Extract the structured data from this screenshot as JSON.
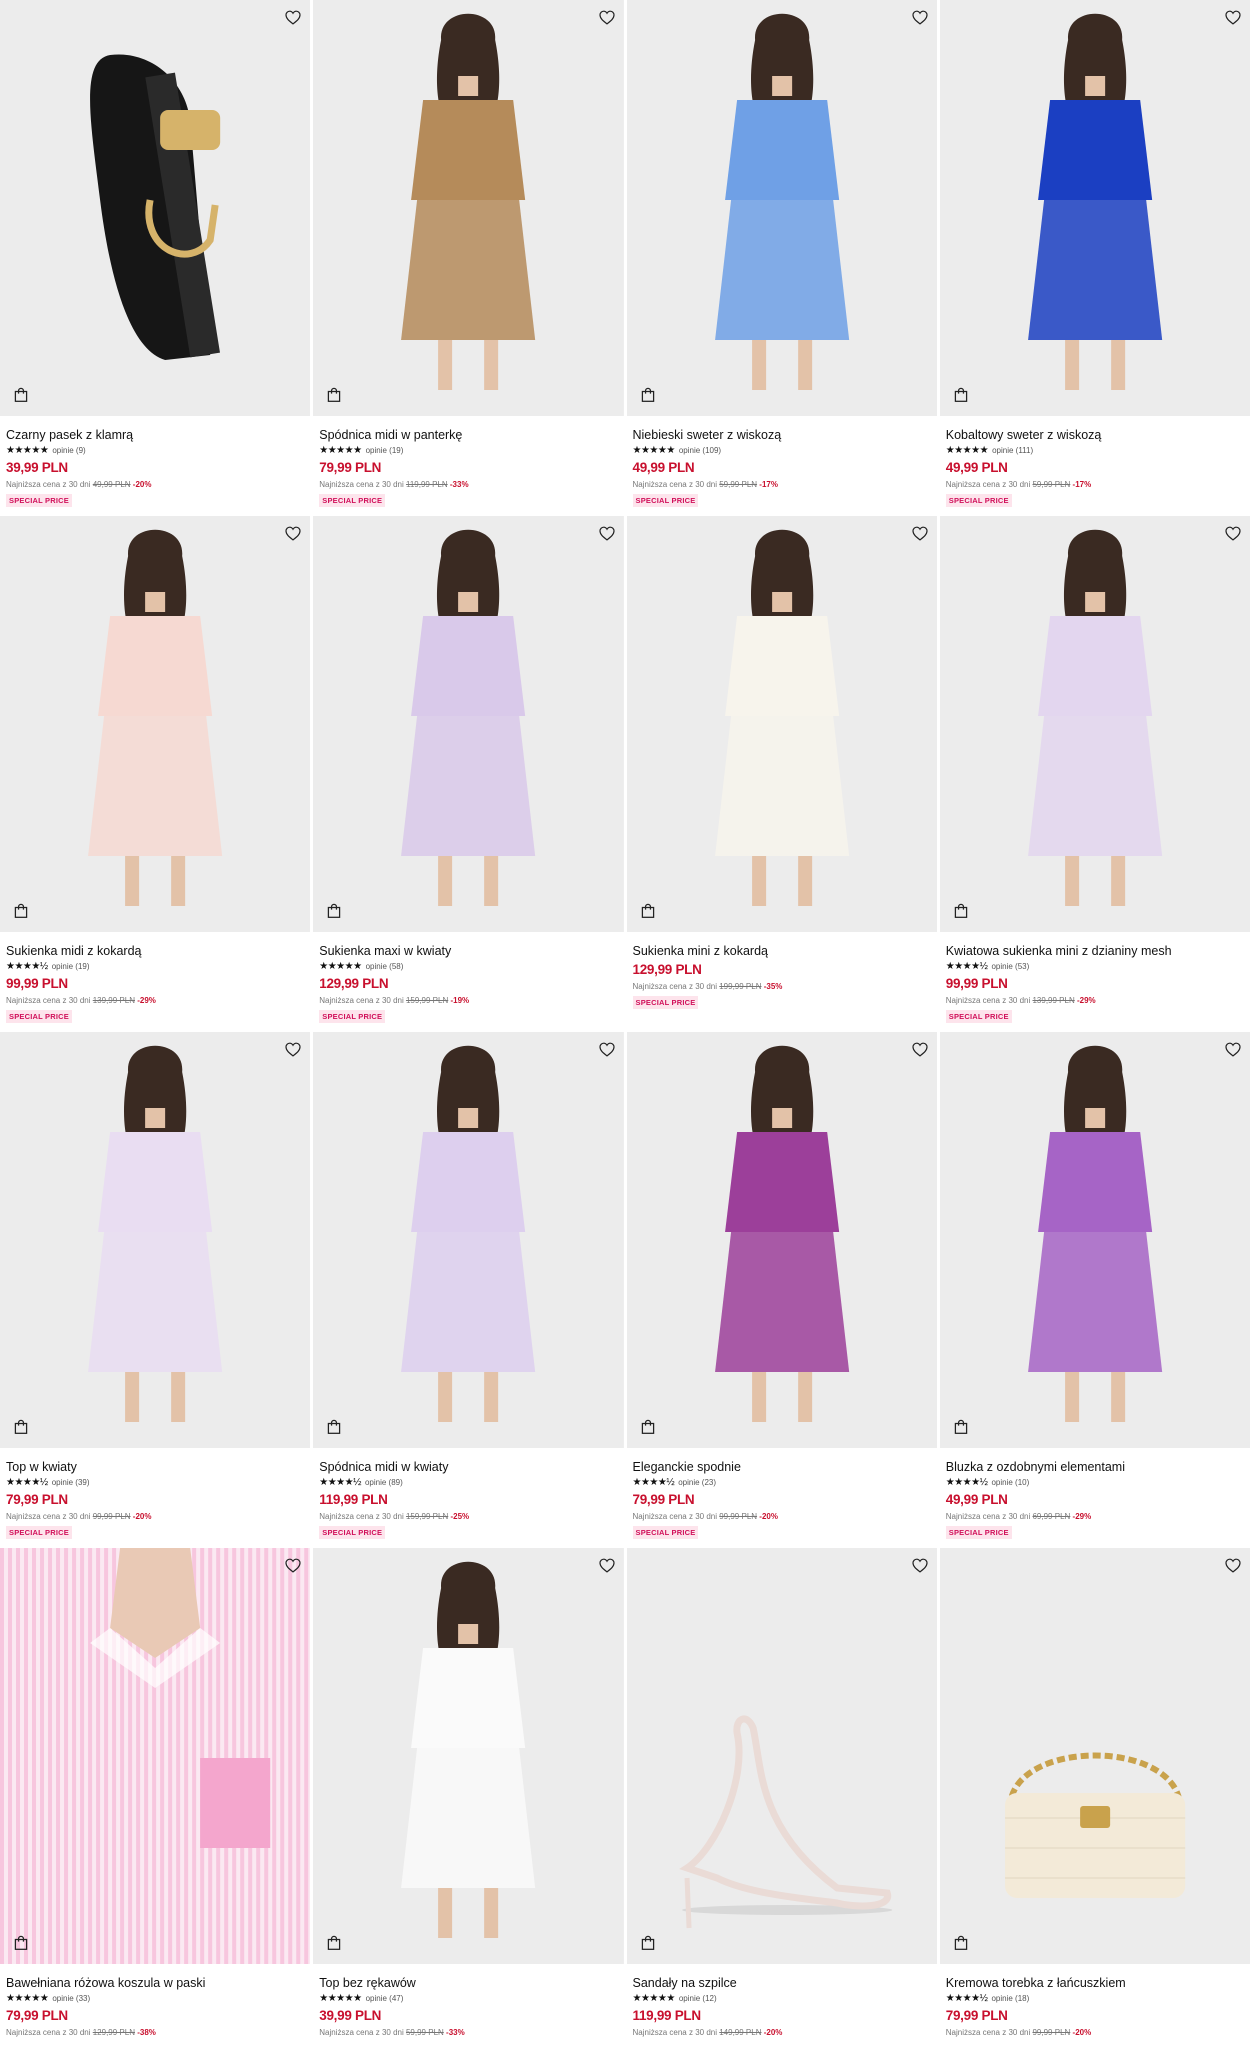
{
  "colors": {
    "price": "#c8102e",
    "badge_bg": "#fde4ec",
    "badge_text": "#d1105a"
  },
  "products": [
    {
      "name": "Czarny pasek z klamrą",
      "stars": "★★★★★",
      "reviews": "opinie (9)",
      "price": "39,99 PLN",
      "lowest_label": "Najniższa cena z 30 dni",
      "old_price": "49,99 PLN",
      "discount": "-20%",
      "badge": "SPECIAL PRICE",
      "image_kind": "belt",
      "accent": "#1a1a1a"
    },
    {
      "name": "Spódnica midi w panterkę",
      "stars": "★★★★★",
      "reviews": "opinie (19)",
      "price": "79,99 PLN",
      "lowest_label": "Najniższa cena z 30 dni",
      "old_price": "119,99 PLN",
      "discount": "-33%",
      "badge": "SPECIAL PRICE",
      "image_kind": "model",
      "accent": "#b58b5a"
    },
    {
      "name": "Niebieski sweter z wiskozą",
      "stars": "★★★★★",
      "reviews": "opinie (109)",
      "price": "49,99 PLN",
      "lowest_label": "Najniższa cena z 30 dni",
      "old_price": "59,99 PLN",
      "discount": "-17%",
      "badge": "SPECIAL PRICE",
      "image_kind": "model",
      "accent": "#6fa0e6"
    },
    {
      "name": "Kobaltowy sweter z wiskozą",
      "stars": "★★★★★",
      "reviews": "opinie (111)",
      "price": "49,99 PLN",
      "lowest_label": "Najniższa cena z 30 dni",
      "old_price": "59,99 PLN",
      "discount": "-17%",
      "badge": "SPECIAL PRICE",
      "image_kind": "model",
      "accent": "#1b3fc2"
    },
    {
      "name": "Sukienka midi z kokardą",
      "stars": "★★★★½",
      "reviews": "opinie (19)",
      "price": "99,99 PLN",
      "lowest_label": "Najniższa cena z 30 dni",
      "old_price": "139,99 PLN",
      "discount": "-29%",
      "badge": "SPECIAL PRICE",
      "image_kind": "model",
      "accent": "#f6d9d2"
    },
    {
      "name": "Sukienka maxi w kwiaty",
      "stars": "★★★★★",
      "reviews": "opinie (58)",
      "price": "129,99 PLN",
      "lowest_label": "Najniższa cena z 30 dni",
      "old_price": "159,99 PLN",
      "discount": "-19%",
      "badge": "SPECIAL PRICE",
      "image_kind": "model",
      "accent": "#d9c9ea"
    },
    {
      "name": "Sukienka mini z kokardą",
      "stars": "",
      "reviews": "",
      "price": "129,99 PLN",
      "lowest_label": "Najniższa cena z 30 dni",
      "old_price": "199,99 PLN",
      "discount": "-35%",
      "badge": "SPECIAL PRICE",
      "image_kind": "model",
      "accent": "#f7f4ec"
    },
    {
      "name": "Kwiatowa sukienka mini z dzianiny mesh",
      "stars": "★★★★½",
      "reviews": "opinie (53)",
      "price": "99,99 PLN",
      "lowest_label": "Najniższa cena z 30 dni",
      "old_price": "139,99 PLN",
      "discount": "-29%",
      "badge": "SPECIAL PRICE",
      "image_kind": "model",
      "accent": "#e3d6ef"
    },
    {
      "name": "Top w kwiaty",
      "stars": "★★★★½",
      "reviews": "opinie (39)",
      "price": "79,99 PLN",
      "lowest_label": "Najniższa cena z 30 dni",
      "old_price": "99,99 PLN",
      "discount": "-20%",
      "badge": "SPECIAL PRICE",
      "image_kind": "model",
      "accent": "#e9ddf2"
    },
    {
      "name": "Spódnica midi w kwiaty",
      "stars": "★★★★½",
      "reviews": "opinie (89)",
      "price": "119,99 PLN",
      "lowest_label": "Najniższa cena z 30 dni",
      "old_price": "159,99 PLN",
      "discount": "-25%",
      "badge": "SPECIAL PRICE",
      "image_kind": "model",
      "accent": "#ddcfee"
    },
    {
      "name": "Eleganckie spodnie",
      "stars": "★★★★½",
      "reviews": "opinie (23)",
      "price": "79,99 PLN",
      "lowest_label": "Najniższa cena z 30 dni",
      "old_price": "99,99 PLN",
      "discount": "-20%",
      "badge": "SPECIAL PRICE",
      "image_kind": "model",
      "accent": "#9c3f9a"
    },
    {
      "name": "Bluzka z ozdobnymi elementami",
      "stars": "★★★★½",
      "reviews": "opinie (10)",
      "price": "49,99 PLN",
      "lowest_label": "Najniższa cena z 30 dni",
      "old_price": "69,99 PLN",
      "discount": "-29%",
      "badge": "SPECIAL PRICE",
      "image_kind": "model",
      "accent": "#a664c6"
    },
    {
      "name": "Bawełniana różowa koszula w paski",
      "stars": "★★★★★",
      "reviews": "opinie (33)",
      "price": "79,99 PLN",
      "lowest_label": "Najniższa cena z 30 dni",
      "old_price": "129,99 PLN",
      "discount": "-38%",
      "badge": "",
      "image_kind": "shirt",
      "accent": "#f2a9cf"
    },
    {
      "name": "Top bez rękawów",
      "stars": "★★★★★",
      "reviews": "opinie (47)",
      "price": "39,99 PLN",
      "lowest_label": "Najniższa cena z 30 dni",
      "old_price": "59,99 PLN",
      "discount": "-33%",
      "badge": "",
      "image_kind": "model",
      "accent": "#fafafa"
    },
    {
      "name": "Sandały na szpilce",
      "stars": "★★★★★",
      "reviews": "opinie (12)",
      "price": "119,99 PLN",
      "lowest_label": "Najniższa cena z 30 dni",
      "old_price": "149,99 PLN",
      "discount": "-20%",
      "badge": "",
      "image_kind": "sandal",
      "accent": "#eadbd6"
    },
    {
      "name": "Kremowa torebka z łańcuszkiem",
      "stars": "★★★★½",
      "reviews": "opinie (18)",
      "price": "79,99 PLN",
      "lowest_label": "Najniższa cena z 30 dni",
      "old_price": "99,99 PLN",
      "discount": "-20%",
      "badge": "",
      "image_kind": "bag",
      "accent": "#f3ead8"
    }
  ]
}
